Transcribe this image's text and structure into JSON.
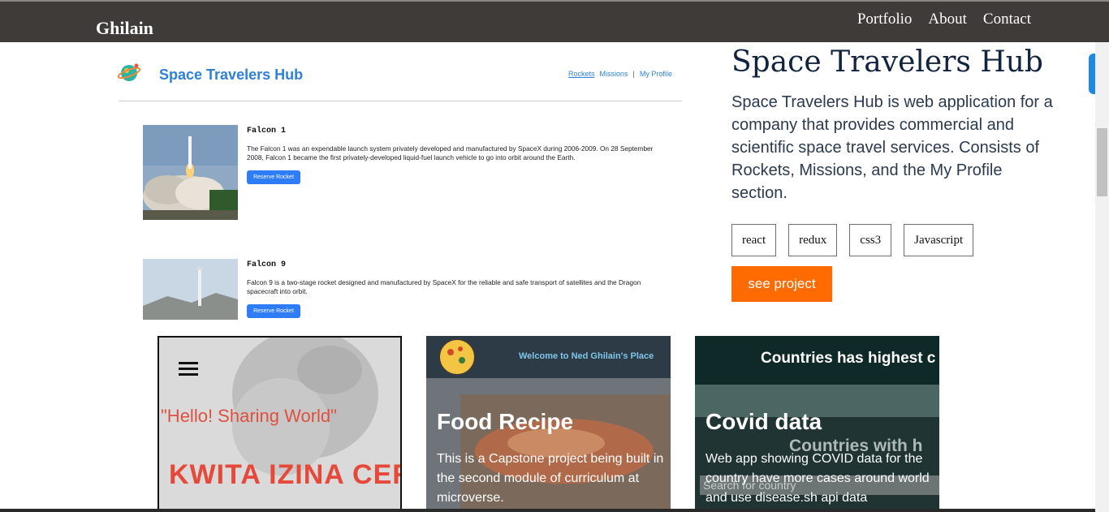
{
  "navbar": {
    "brand": "Ghilain",
    "links": [
      "Portfolio",
      "About",
      "Contact"
    ]
  },
  "screenshot": {
    "app_title": "Space Travelers Hub",
    "nav": [
      "Rockets",
      "Missions",
      "My Profile"
    ],
    "separator": "|",
    "rockets": [
      {
        "name": "Falcon 1",
        "description": "The Falcon 1 was an expendable launch system privately developed and manufactured by SpaceX during 2006-2009. On 28 September 2008, Falcon 1 became the first privately-developed liquid-fuel launch vehicle to go into orbit around the Earth.",
        "button": "Reserve Rocket"
      },
      {
        "name": "Falcon 9",
        "description": "Falcon 9 is a two-stage rocket designed and manufactured by SpaceX for the reliable and safe transport of satellites and the Dragon spacecraft into orbit.",
        "button": "Reserve Rocket"
      }
    ]
  },
  "project": {
    "title": "Space Travelers Hub",
    "description": "Space Travelers Hub is web application for a company that provides commercial and scientific space travel services. Consists of Rockets, Missions, and the My Profile section.",
    "tags": [
      "react",
      "redux",
      "css3",
      "Javascript"
    ],
    "button": "see project"
  },
  "cards": [
    {
      "hello": "\"Hello! Sharing World\"",
      "banner": "KWITA IZINA CER"
    },
    {
      "welcome": "Welcome to Ned Ghilain's Place",
      "title": "Food Recipe",
      "text": "This is a Capstone project being built in the second module of curriculum at microverse."
    },
    {
      "header": "Countries has highest c",
      "ghost": "Countries with h",
      "search": "Search for country",
      "title": "Covid data",
      "text": "Web app showing COVID data for the country have more cases around world and use disease.sh api data"
    }
  ],
  "colors": {
    "navbar": "#3e3b39",
    "accent": "#ff6b00",
    "link_blue": "#2f80d8"
  }
}
